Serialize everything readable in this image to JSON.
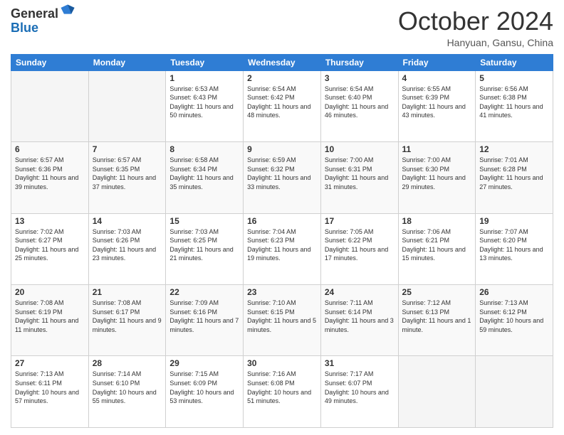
{
  "logo": {
    "general": "General",
    "blue": "Blue"
  },
  "header": {
    "month": "October 2024",
    "location": "Hanyuan, Gansu, China"
  },
  "weekdays": [
    "Sunday",
    "Monday",
    "Tuesday",
    "Wednesday",
    "Thursday",
    "Friday",
    "Saturday"
  ],
  "weeks": [
    [
      {
        "day": "",
        "empty": true
      },
      {
        "day": "",
        "empty": true
      },
      {
        "day": "1",
        "sunrise": "6:53 AM",
        "sunset": "6:43 PM",
        "daylight": "11 hours and 50 minutes."
      },
      {
        "day": "2",
        "sunrise": "6:54 AM",
        "sunset": "6:42 PM",
        "daylight": "11 hours and 48 minutes."
      },
      {
        "day": "3",
        "sunrise": "6:54 AM",
        "sunset": "6:40 PM",
        "daylight": "11 hours and 46 minutes."
      },
      {
        "day": "4",
        "sunrise": "6:55 AM",
        "sunset": "6:39 PM",
        "daylight": "11 hours and 43 minutes."
      },
      {
        "day": "5",
        "sunrise": "6:56 AM",
        "sunset": "6:38 PM",
        "daylight": "11 hours and 41 minutes."
      }
    ],
    [
      {
        "day": "6",
        "sunrise": "6:57 AM",
        "sunset": "6:36 PM",
        "daylight": "11 hours and 39 minutes."
      },
      {
        "day": "7",
        "sunrise": "6:57 AM",
        "sunset": "6:35 PM",
        "daylight": "11 hours and 37 minutes."
      },
      {
        "day": "8",
        "sunrise": "6:58 AM",
        "sunset": "6:34 PM",
        "daylight": "11 hours and 35 minutes."
      },
      {
        "day": "9",
        "sunrise": "6:59 AM",
        "sunset": "6:32 PM",
        "daylight": "11 hours and 33 minutes."
      },
      {
        "day": "10",
        "sunrise": "7:00 AM",
        "sunset": "6:31 PM",
        "daylight": "11 hours and 31 minutes."
      },
      {
        "day": "11",
        "sunrise": "7:00 AM",
        "sunset": "6:30 PM",
        "daylight": "11 hours and 29 minutes."
      },
      {
        "day": "12",
        "sunrise": "7:01 AM",
        "sunset": "6:28 PM",
        "daylight": "11 hours and 27 minutes."
      }
    ],
    [
      {
        "day": "13",
        "sunrise": "7:02 AM",
        "sunset": "6:27 PM",
        "daylight": "11 hours and 25 minutes."
      },
      {
        "day": "14",
        "sunrise": "7:03 AM",
        "sunset": "6:26 PM",
        "daylight": "11 hours and 23 minutes."
      },
      {
        "day": "15",
        "sunrise": "7:03 AM",
        "sunset": "6:25 PM",
        "daylight": "11 hours and 21 minutes."
      },
      {
        "day": "16",
        "sunrise": "7:04 AM",
        "sunset": "6:23 PM",
        "daylight": "11 hours and 19 minutes."
      },
      {
        "day": "17",
        "sunrise": "7:05 AM",
        "sunset": "6:22 PM",
        "daylight": "11 hours and 17 minutes."
      },
      {
        "day": "18",
        "sunrise": "7:06 AM",
        "sunset": "6:21 PM",
        "daylight": "11 hours and 15 minutes."
      },
      {
        "day": "19",
        "sunrise": "7:07 AM",
        "sunset": "6:20 PM",
        "daylight": "11 hours and 13 minutes."
      }
    ],
    [
      {
        "day": "20",
        "sunrise": "7:08 AM",
        "sunset": "6:19 PM",
        "daylight": "11 hours and 11 minutes."
      },
      {
        "day": "21",
        "sunrise": "7:08 AM",
        "sunset": "6:17 PM",
        "daylight": "11 hours and 9 minutes."
      },
      {
        "day": "22",
        "sunrise": "7:09 AM",
        "sunset": "6:16 PM",
        "daylight": "11 hours and 7 minutes."
      },
      {
        "day": "23",
        "sunrise": "7:10 AM",
        "sunset": "6:15 PM",
        "daylight": "11 hours and 5 minutes."
      },
      {
        "day": "24",
        "sunrise": "7:11 AM",
        "sunset": "6:14 PM",
        "daylight": "11 hours and 3 minutes."
      },
      {
        "day": "25",
        "sunrise": "7:12 AM",
        "sunset": "6:13 PM",
        "daylight": "11 hours and 1 minute."
      },
      {
        "day": "26",
        "sunrise": "7:13 AM",
        "sunset": "6:12 PM",
        "daylight": "10 hours and 59 minutes."
      }
    ],
    [
      {
        "day": "27",
        "sunrise": "7:13 AM",
        "sunset": "6:11 PM",
        "daylight": "10 hours and 57 minutes."
      },
      {
        "day": "28",
        "sunrise": "7:14 AM",
        "sunset": "6:10 PM",
        "daylight": "10 hours and 55 minutes."
      },
      {
        "day": "29",
        "sunrise": "7:15 AM",
        "sunset": "6:09 PM",
        "daylight": "10 hours and 53 minutes."
      },
      {
        "day": "30",
        "sunrise": "7:16 AM",
        "sunset": "6:08 PM",
        "daylight": "10 hours and 51 minutes."
      },
      {
        "day": "31",
        "sunrise": "7:17 AM",
        "sunset": "6:07 PM",
        "daylight": "10 hours and 49 minutes."
      },
      {
        "day": "",
        "empty": true
      },
      {
        "day": "",
        "empty": true
      }
    ]
  ]
}
